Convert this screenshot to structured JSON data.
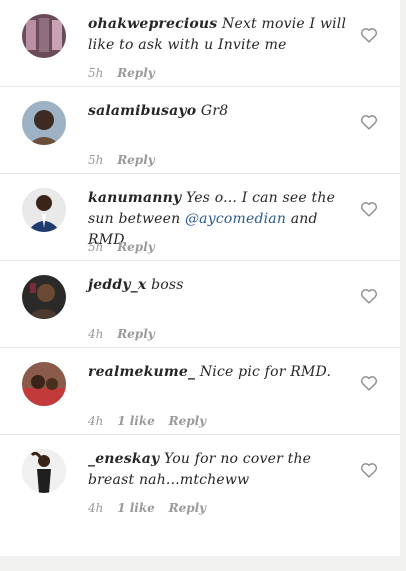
{
  "comments": [
    {
      "username": "ohakweprecious",
      "text": " Next movie I will like to ask with u Invite me",
      "time": "5h",
      "likes": "",
      "reply": "Reply"
    },
    {
      "username": "salamibusayo",
      "text": " Gr8",
      "time": "5h",
      "likes": "",
      "reply": "Reply"
    },
    {
      "username": "kanumanny",
      "text_before": " Yes o... I can see the sun between ",
      "mention": "@aycomedian",
      "text_after": " and RMD",
      "time": "5h",
      "likes": "",
      "reply": "Reply"
    },
    {
      "username": "jeddy_x",
      "text": " boss",
      "time": "4h",
      "likes": "",
      "reply": "Reply"
    },
    {
      "username": "realmekume_",
      "text": " Nice pic for RMD.",
      "time": "4h",
      "likes": "1 like",
      "reply": "Reply"
    },
    {
      "username": "_eneskay",
      "text": " You for no cover the breast nah...mtcheww",
      "time": "4h",
      "likes": "1 like",
      "reply": "Reply"
    }
  ],
  "icons": {
    "like": "heart-outline-icon"
  },
  "colors": {
    "mention": "#2d5a8e",
    "meta": "#9a9a9a",
    "text": "#262626"
  }
}
